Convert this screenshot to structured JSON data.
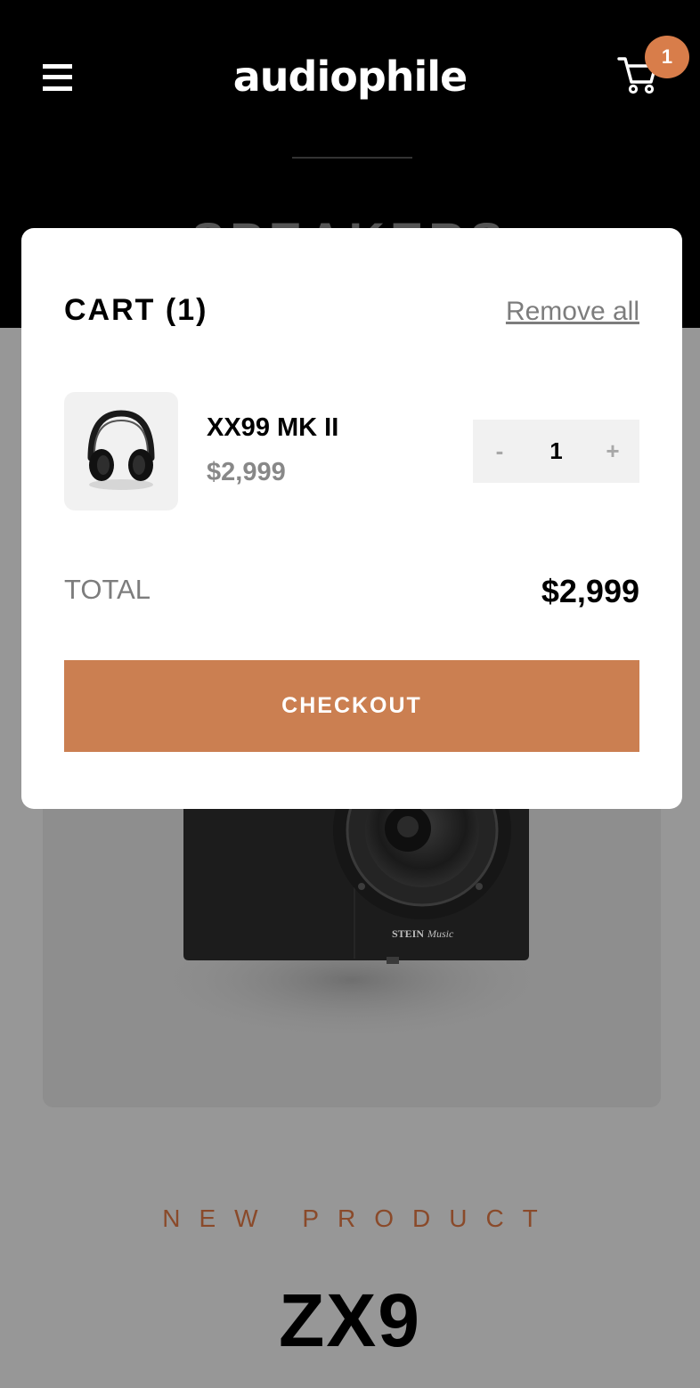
{
  "header": {
    "logo": "audiophile",
    "cart_count": "1",
    "category_heading": "SPEAKERS",
    "icons": {
      "menu": "hamburger-icon",
      "cart": "cart-icon"
    }
  },
  "cart": {
    "title": "CART (1)",
    "remove_all_label": "Remove all",
    "items": [
      {
        "name": "XX99 MK II",
        "price": "$2,999",
        "quantity": "1",
        "minus_label": "-",
        "plus_label": "+",
        "image_icon": "headphones-image"
      }
    ],
    "total_label": "TOTAL",
    "total_value": "$2,999",
    "checkout_label": "CHECKOUT"
  },
  "product": {
    "overline": "NEW PRODUCT",
    "title": "ZX9",
    "image_icon": "speaker-image"
  },
  "colors": {
    "accent": "#D87D4A",
    "overlay": "#979797",
    "header_bg": "#000000"
  }
}
